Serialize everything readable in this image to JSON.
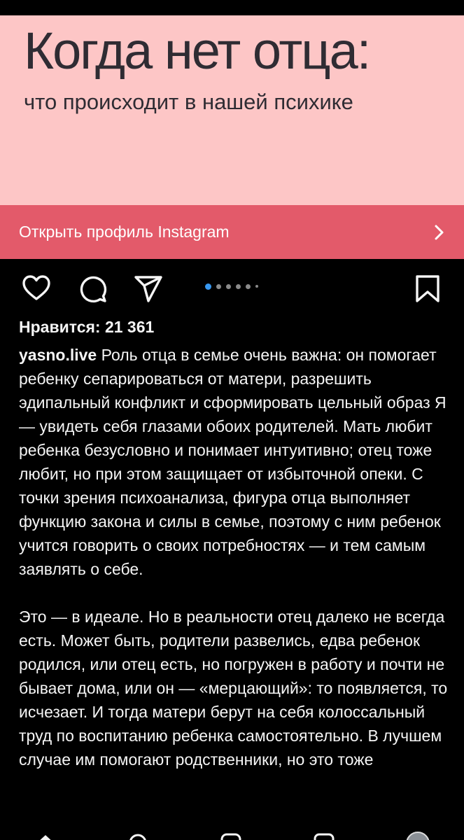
{
  "post_image": {
    "title": "Когда нет отца:",
    "subtitle": "что происходит в нашей психике",
    "background": "#fdc6c6"
  },
  "profile_banner": {
    "label": "Открыть профиль Instagram",
    "color": "#e35a6a"
  },
  "actions": {
    "icons": [
      "heart-icon",
      "comment-icon",
      "share-icon",
      "bookmark-icon"
    ],
    "carousel": {
      "count": 6,
      "active": 0,
      "active_color": "#3797f0"
    }
  },
  "likes": "Нравится: 21 361",
  "caption": {
    "username": "yasno.live",
    "paragraph1": " Роль отца в семье очень важна: он помогает ребенку сепарироваться от матери, разрешить эдипальный конфликт и сформировать цельный образ Я — увидеть себя глазами обоих родителей. Мать любит ребенка безусловно и понимает интуитивно; отец тоже любит, но при этом защищает от избыточной опеки. С точки зрения психоанализа, фигура отца выполняет функцию закона и силы в семье, поэтому с  ним ребенок учится говорить о своих потребностях — и тем самым заявлять о себе.",
    "paragraph2": "Это — в идеале. Но в реальности отец далеко не всегда есть. Может быть, родители развелись, едва ребенок родился, или отец есть, но погружен в работу и почти не бывает дома, или он — «мерцающий»: то появляется, то исчезает. И тогда матери берут на себя колоссальный труд по воспитанию ребенка самостоятельно. В лучшем случае им помогают родственники, но это тоже"
  },
  "bottom_nav": {
    "icons": [
      "home-icon",
      "search-icon",
      "reels-icon",
      "shop-icon",
      "profile-avatar"
    ]
  }
}
